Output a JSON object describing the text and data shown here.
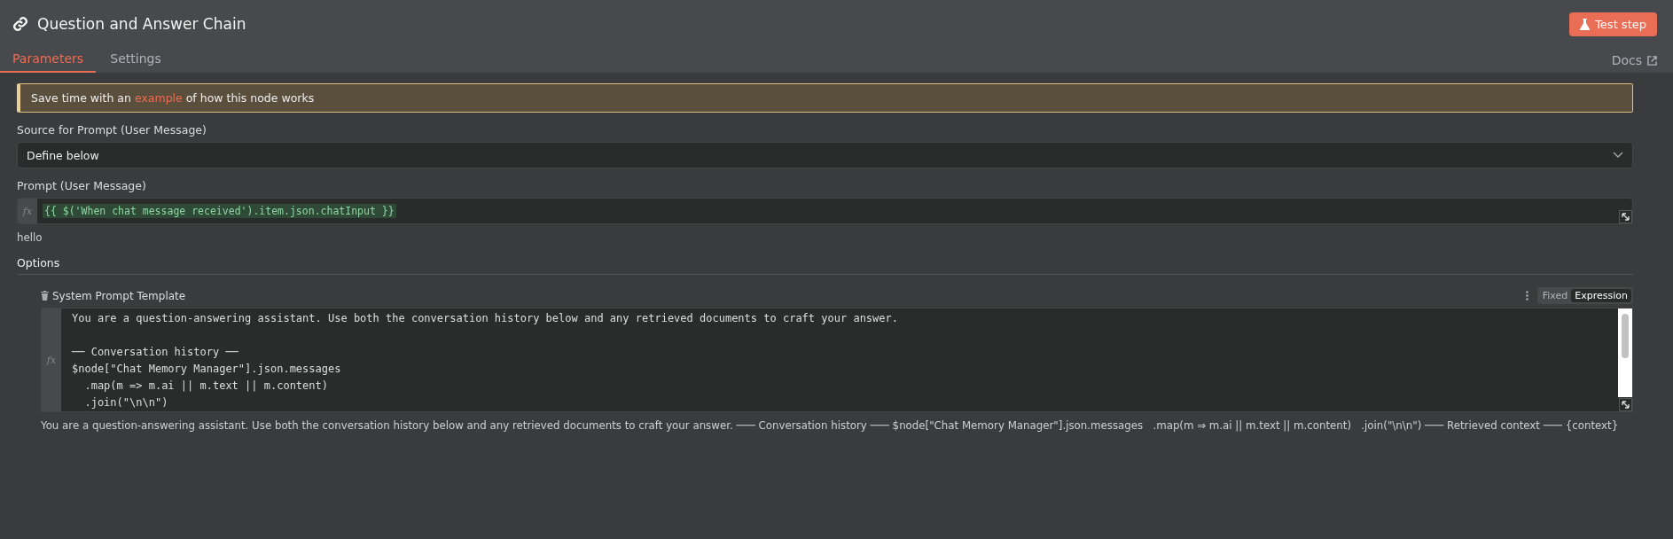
{
  "header": {
    "title": "Question and Answer Chain",
    "test_button": "Test step"
  },
  "tabs": [
    {
      "label": "Parameters",
      "selected": true
    },
    {
      "label": "Settings",
      "selected": false
    }
  ],
  "docs_link": "Docs",
  "notice": "Save time with an **example** of how this node works",
  "source_field": {
    "label": "Source for Prompt (User Message)",
    "value": "Define below"
  },
  "prompt_field": {
    "label": "Prompt (User Message)",
    "fx": "fx",
    "value": "{{ $('When chat message received').item.json.chatInput }}",
    "preview": "hello"
  },
  "options": {
    "title": "Options",
    "items": [
      {
        "label": "System Prompt Template",
        "modes": [
          {
            "label": "Fixed",
            "selected": false
          },
          {
            "label": "Expression",
            "selected": true
          }
        ],
        "fx": "fx",
        "code_blocks": [
          [
            "You are a question-answering assistant. Use both the conversation history below and any retrieved documents to craft your answer."
          ],
          [
            "── Conversation history ──",
            "$node[\"Chat Memory Manager\"].json.messages",
            "  .map(m => m.ai || m.text || m.content)",
            "  .join(\"\\n\\n\")"
          ]
        ],
        "preview": "You are a question-answering assistant. Use both the conversation history below and any retrieved documents to craft your answer. ─── Conversation history ─── $node[\"Chat Memory Manager\"].json.messages   .map(m ⇒ m.ai || m.text || m.content)   .join(\"\\n\\n\") ─── Retrieved context ─── {context}"
      }
    ]
  }
}
